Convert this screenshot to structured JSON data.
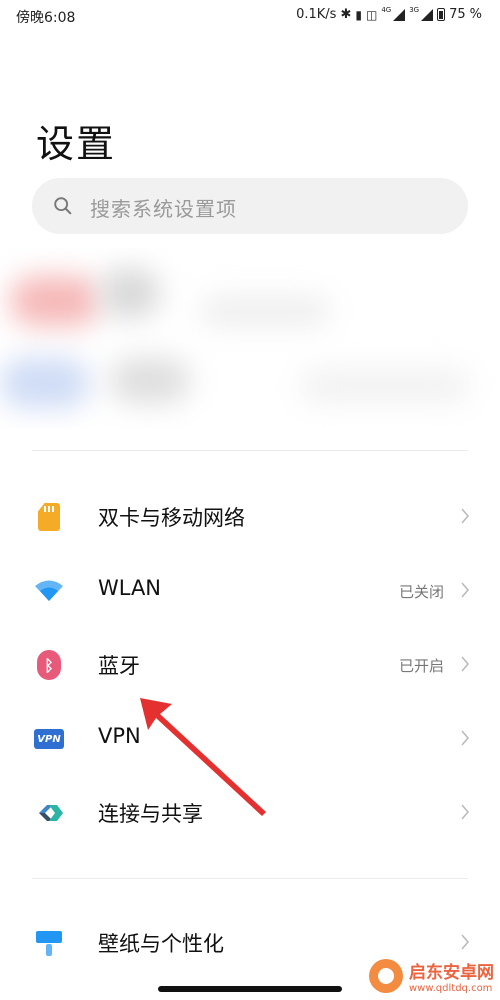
{
  "status_bar": {
    "time": "傍晚6:08",
    "network_speed": "0.1K/s",
    "signal_1_label": "4G",
    "signal_2_label": "3G",
    "battery": "75"
  },
  "page_title": "设置",
  "search": {
    "placeholder": "搜索系统设置项"
  },
  "settings": {
    "sim": {
      "label": "双卡与移动网络",
      "status": ""
    },
    "wlan": {
      "label": "WLAN",
      "status": "已关闭"
    },
    "bluetooth": {
      "label": "蓝牙",
      "status": "已开启"
    },
    "vpn": {
      "label": "VPN",
      "icon_text": "VPN",
      "status": ""
    },
    "connection": {
      "label": "连接与共享",
      "status": ""
    },
    "wallpaper": {
      "label": "壁纸与个性化",
      "status": ""
    }
  },
  "icons": {
    "sim": "sim-card-icon",
    "wlan": "wifi-icon",
    "bluetooth": "bluetooth-icon",
    "vpn": "vpn-icon",
    "connection": "share-icon",
    "wallpaper": "paintbrush-icon"
  },
  "colors": {
    "sim": "#f6ab26",
    "wlan": "#2196f3",
    "bluetooth": "#e85a7a",
    "vpn": "#2f6fd1",
    "arrow": "#e53030"
  },
  "watermark": {
    "name": "启东安卓网",
    "url": "www.qdltdq.com"
  }
}
